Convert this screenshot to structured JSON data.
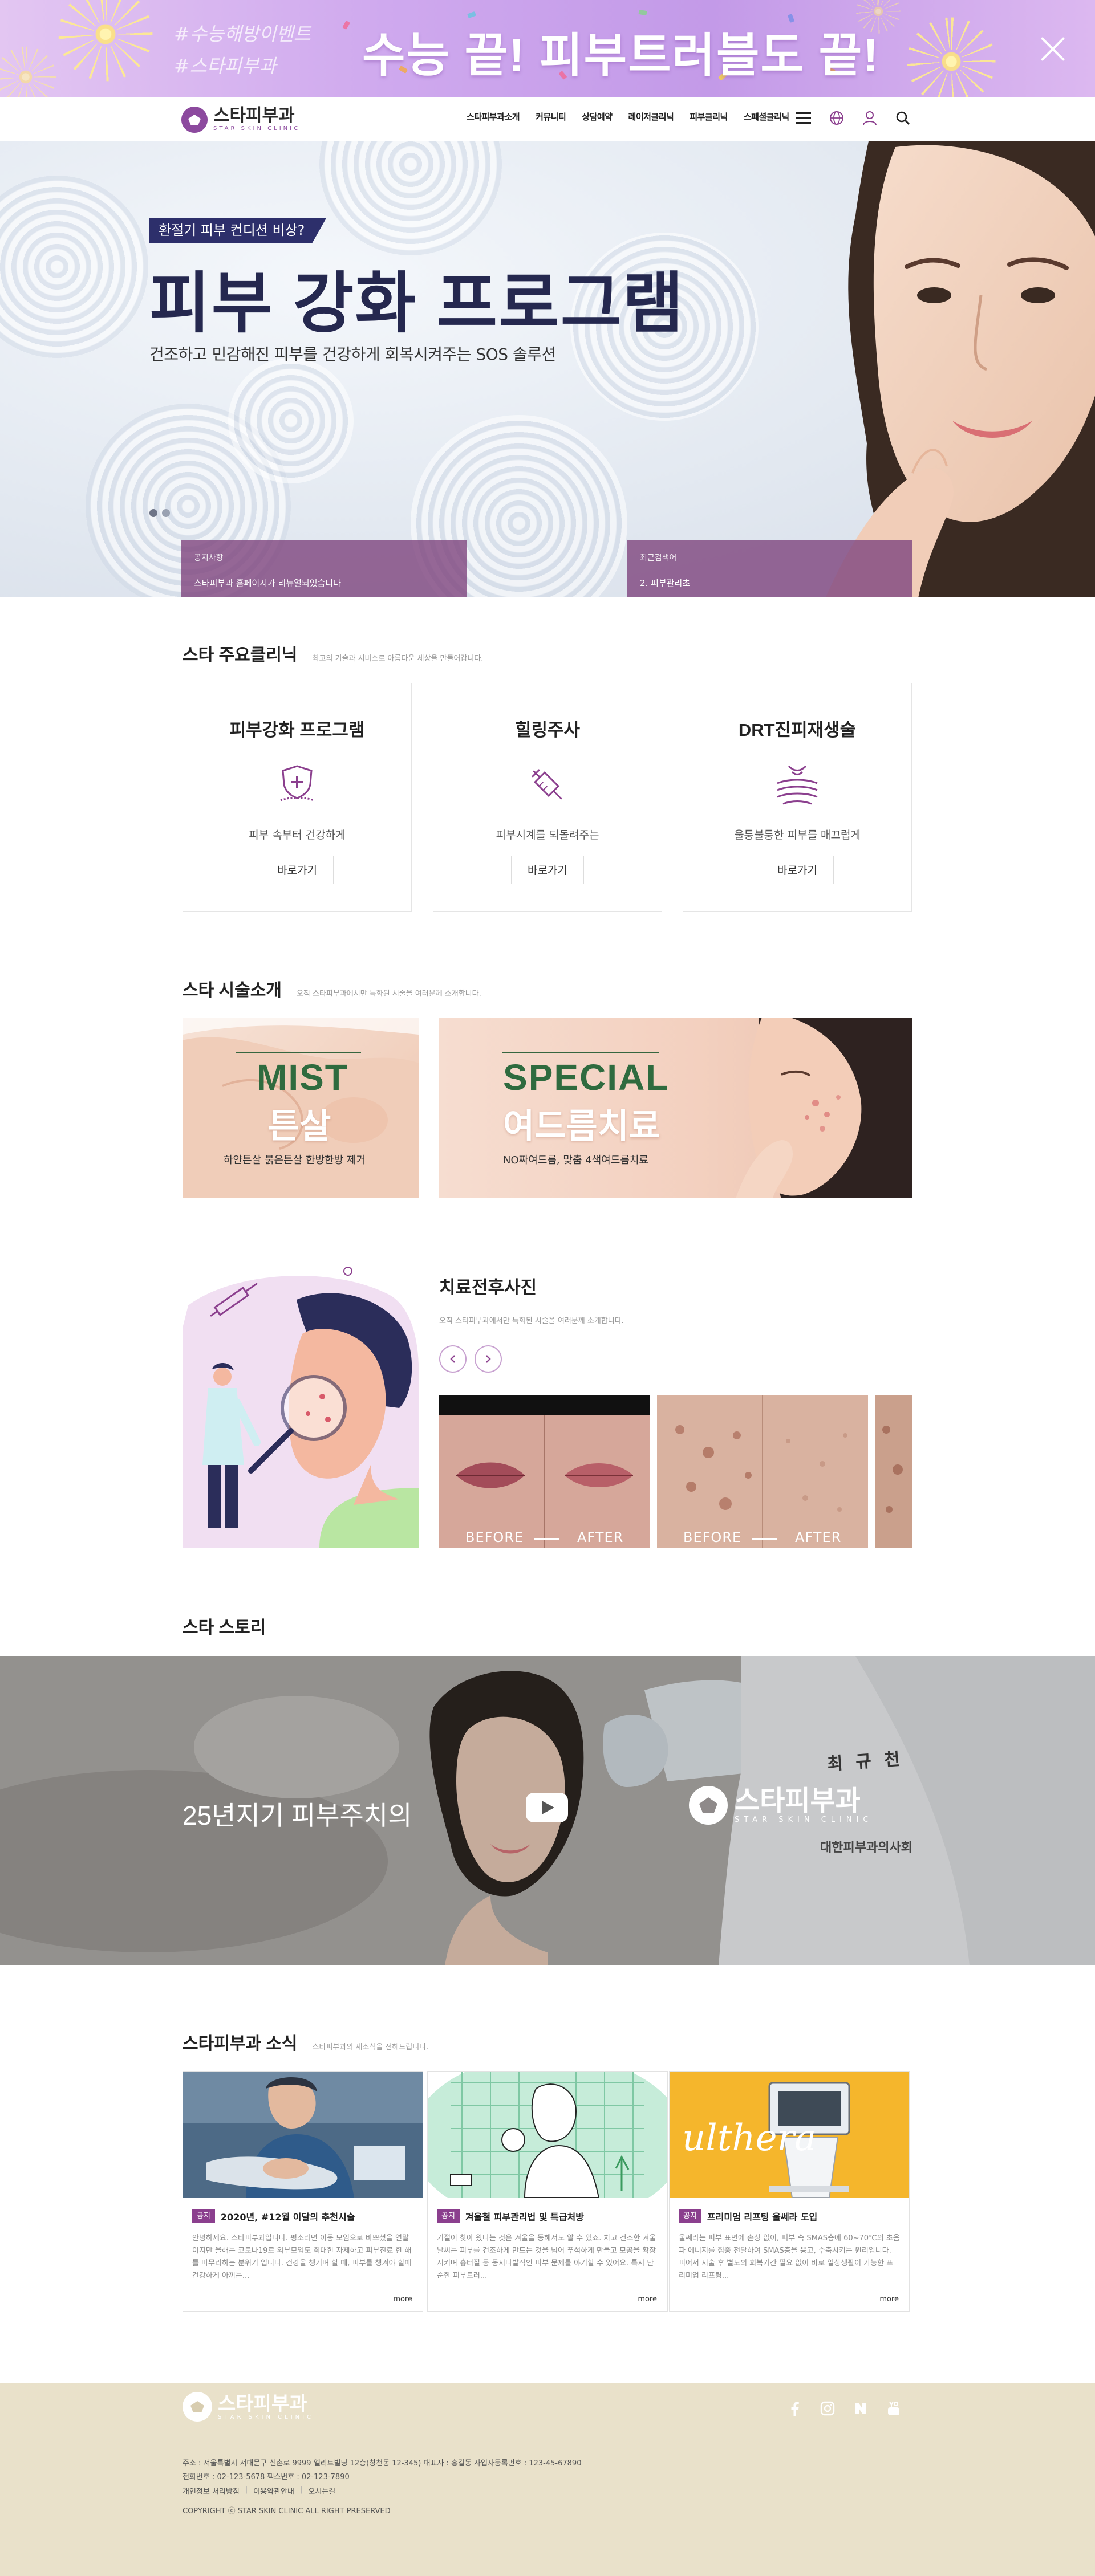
{
  "promo": {
    "hashtags": [
      "#수능해방이벤트",
      "#스타피부과"
    ],
    "title": "수능 끝! 피부트러블도 끝!"
  },
  "header": {
    "logo_ko": "스타피부과",
    "logo_en": "STAR SKIN CLINIC",
    "nav": [
      "스타피부과소개",
      "커뮤니티",
      "상담예약",
      "레이저클리닉",
      "피부클리닉",
      "스페셜클리닉"
    ],
    "icons": [
      "menu-icon",
      "globe-icon",
      "user-icon",
      "search-icon"
    ]
  },
  "hero": {
    "tag": "환절기 피부 컨디션 비상?",
    "title": "피부 강화  프로그램",
    "subtitle": "건조하고 민감해진 피부를 건강하게 회복시켜주는 SOS 솔루션",
    "notice_left": {
      "label": "공지사항",
      "text": "스타피부과 홈페이지가 리뉴얼되었습니다"
    },
    "notice_right": {
      "label": "최근검색어",
      "text": "2. 피부관리초"
    }
  },
  "clinics": {
    "title": "스타 주요클리닉",
    "subtitle": "최고의 기술과 서비스로 아름다운 세상을 만들어갑니다.",
    "cards": [
      {
        "title": "피부강화 프로그램",
        "desc": "피부 속부터 건강하게",
        "button": "바로가기",
        "icon": "skin-shield-icon"
      },
      {
        "title": "힐링주사",
        "desc": "피부시계를 되돌려주는",
        "button": "바로가기",
        "icon": "syringe-icon"
      },
      {
        "title": "DRT진피재생술",
        "desc": "울퉁불퉁한 피부를 매끄럽게",
        "button": "바로가기",
        "icon": "skin-layer-icon"
      }
    ]
  },
  "treatments": {
    "title": "스타 시술소개",
    "subtitle": "오직 스타피부과에서만 특화된 시술을 여러분께 소개합니다.",
    "items": [
      {
        "en": "MIST",
        "ko": "튼살",
        "sub": "하얀튼살 붉은튼살 한방한방 제거"
      },
      {
        "en": "SPECIAL",
        "ko": "여드름치료",
        "sub": "NO짜여드름, 맞춤 4색여드름치료"
      }
    ]
  },
  "before_after": {
    "title": "치료전후사진",
    "subtitle": "오직 스타피부과에서만 특화된 시술을 여러분께 소개합니다.",
    "before_label": "BEFORE",
    "after_label": "AFTER"
  },
  "story": {
    "title": "스타 스토리",
    "video_text": "25년지기 피부주치의",
    "logo_ko": "스타피부과",
    "logo_en": "STAR SKIN CLINIC",
    "coat_name": "최 규 천",
    "coat_sub": "대한피부과의사회"
  },
  "news": {
    "title": "스타피부과 소식",
    "subtitle": "스타피부과의 새소식을 전해드립니다.",
    "more": "more",
    "items": [
      {
        "tag": "공지",
        "title": "2020년, #12월 이달의 추천시술",
        "text": "안녕하세요. 스타피부과입니다. 평소라면 이동 모임으로 바쁘셨을 연말이지만 올해는 코로나19로 외부모임도 최대한 자제하고 피부진료 한 해를 마무리하는 분위기 입니다. 건강을 챙기며 할 때, 피부를 챙겨야 할때 건강하게 아끼는..."
      },
      {
        "tag": "공지",
        "title": "겨울철 피부관리법 및 특급처방",
        "text": "기절이 찾아 왔다는 것은 겨울을 동해서도 알 수 있죠. 차고 건조한 겨울날씨는 피부를 건조하게 만드는 것을 넘어 푸석하게 만들고 모공을 확장시키며 흉터질 등 동시다발적인 피부 문제를 야기할 수 있어요. 특시 단순한 피부트러..."
      },
      {
        "tag": "공지",
        "title": "프리미엄 리프팅 울쎄라 도입",
        "text": "울쎄라는 피부 표면에 손상 없이, 피부 속 SMAS층에 60~70℃의 초음파 에너지를 집중 전달하여 SMAS층을 응고, 수축시키는 원리입니다. 피어서 시술 후 별도의 회복기간 필요 없이 바로 일상생활이 가능한 프리미엄 리프팅..."
      }
    ],
    "ulthera_text": "ulthera"
  },
  "footer": {
    "logo_ko": "스타피부과",
    "logo_en": "STAR SKIN CLINIC",
    "address": "주소 : 서울특별시 서대문구 신촌로 9999 엘리트빌딩 12층(창천동 12-345)   대표자 : 홍길동   사업자등록번호 : 123-45-67890",
    "contact": "전화번호 : 02-123-5678   팩스번호 : 02-123-7890",
    "links": [
      "개인정보 처리방침",
      "이용약관안내",
      "오시는길"
    ],
    "copyright": "COPYRIGHT ⓒ STAR SKIN CLINIC ALL RIGHT PRESERVED",
    "sns": [
      "facebook-icon",
      "instagram-icon",
      "naver-blog-icon",
      "youtube-icon"
    ]
  },
  "colors": {
    "brand_purple": "#8b3f8e",
    "navy": "#25284f",
    "footer_bg": "#e9e1ca"
  }
}
